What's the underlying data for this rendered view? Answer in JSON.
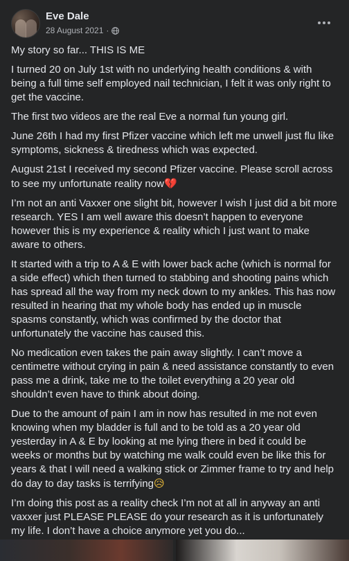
{
  "post": {
    "author": "Eve Dale",
    "date": "28 August 2021",
    "separator": "·",
    "privacy_icon": "globe-icon",
    "more_icon": "more-options-icon",
    "paragraphs": [
      {
        "text": "My story so far... THIS IS ME"
      },
      {
        "text": "I turned 20 on July 1st with no underlying health conditions & with being a full  time self employed nail technician, I felt it was only right to get the vaccine."
      },
      {
        "text": "The first two videos are the real Eve a normal fun young girl."
      },
      {
        "text": "June 26th I had my first Pfizer vaccine which left me unwell just flu like symptoms, sickness & tiredness which was expected."
      },
      {
        "text": "August 21st I received my second Pfizer vaccine. Please scroll across to see my unfortunate reality now",
        "emoji": "💔"
      },
      {
        "text": "I’m not an anti Vaxxer one slight bit, however I wish I just did a bit more research. YES I am well aware this doesn’t happen to everyone however this is my experience & reality which I just want to make aware to others."
      },
      {
        "text": "It started with a trip to A & E with lower back ache (which is normal for a side effect) which then turned to stabbing and shooting pains which has spread all the way from my neck down to my ankles. This has now resulted in hearing that my whole body has ended up in muscle spasms constantly, which was confirmed by the doctor that unfortunately the vaccine has caused this."
      },
      {
        "text": "No medication even takes the pain away slightly. I can’t move a centimetre without crying in pain & need assistance constantly to even pass me a drink, take me to the toilet everything a 20 year old shouldn’t even have to think about doing."
      },
      {
        "text": "Due to the amount of pain I am in now has resulted in me not even knowing when my bladder is full and to be told as a 20 year old yesterday in A & E by looking at me lying there in bed it could be weeks or months but by watching me walk could even be like this for years & that I will need a walking stick or Zimmer frame to try and help do day to day tasks is terrifying",
        "emoji": "😥"
      },
      {
        "text": "I’m doing this post as a reality check I’m not at all in anyway an anti vaxxer just PLEASE PLEASE do your research as it is unfortunately my life. I don’t have a choice anymore yet you do..."
      }
    ]
  }
}
